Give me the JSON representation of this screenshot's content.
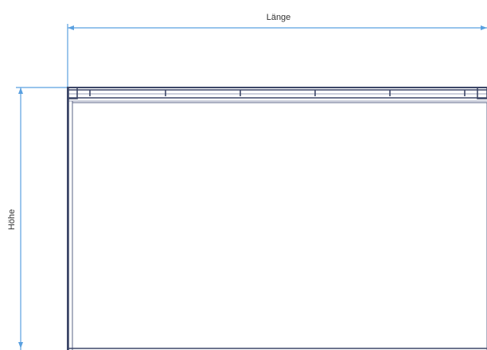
{
  "dimensions": {
    "length_label": "Länge",
    "height_label": "Höhe"
  },
  "colors": {
    "dimension_line": "#5aa0e0",
    "frame": "#3d4768",
    "label_text": "#333333"
  }
}
